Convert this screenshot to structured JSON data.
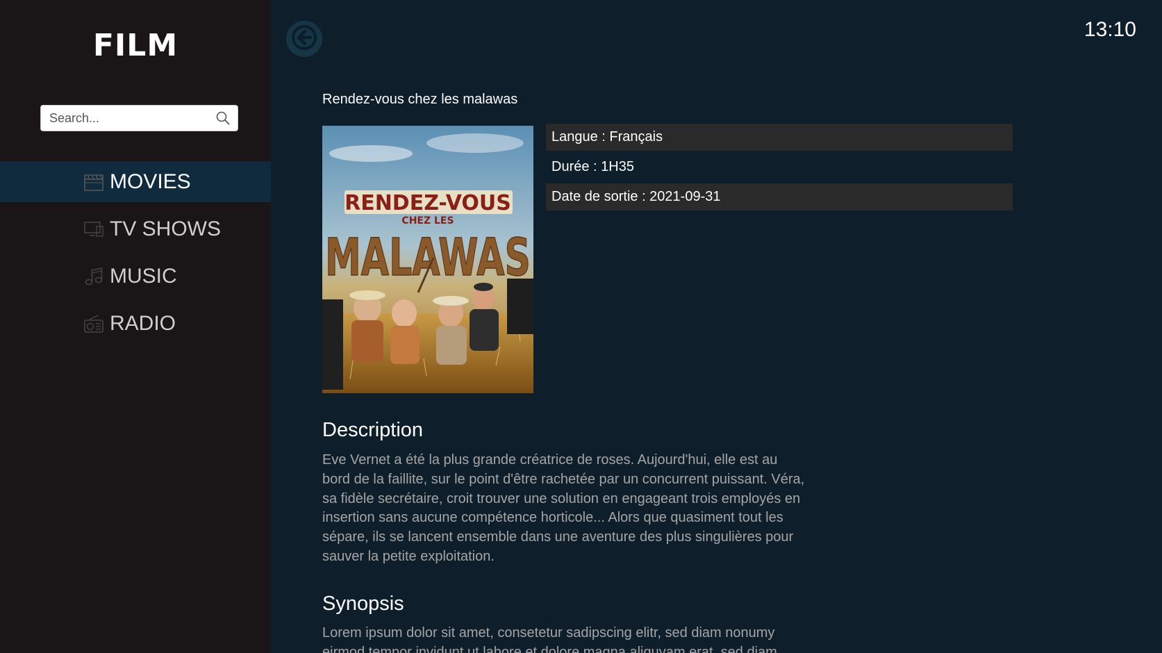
{
  "sidebar": {
    "logo": "FILM",
    "search": {
      "placeholder": "Search...",
      "value": ""
    },
    "items": [
      {
        "label": "MOVIES",
        "icon": "clapperboard-icon",
        "active": true
      },
      {
        "label": "TV SHOWS",
        "icon": "tv-icon",
        "active": false
      },
      {
        "label": "MUSIC",
        "icon": "music-note-icon",
        "active": false
      },
      {
        "label": "RADIO",
        "icon": "radio-icon",
        "active": false
      }
    ]
  },
  "header": {
    "back_icon": "arrow-left-icon",
    "clock": "13:10"
  },
  "movie": {
    "title": "Rendez-vous chez les malawas",
    "poster": {
      "line1": "RENDEZ-VOUS",
      "line2": "CHEZ LES",
      "line3": "MALAWAS"
    },
    "info": [
      "Langue : Français",
      "Durée : 1H35",
      "Date de sortie : 2021-09-31"
    ],
    "description_title": "Description",
    "description": "Eve Vernet a été la plus grande créatrice de roses. Aujourd'hui, elle est au bord de la faillite, sur le point d'être rachetée par un concurrent puissant. Véra, sa fidèle secrétaire, croit trouver une solution en engageant trois employés en insertion sans aucune compétence horticole... Alors que quasiment tout les sépare, ils se lancent ensemble dans une aventure des plus singulières pour sauver la petite exploitation.",
    "synopsis_title": "Synopsis",
    "synopsis": "Lorem ipsum dolor sit amet, consetetur sadipscing elitr, sed diam nonumy eirmod tempor invidunt ut labore et dolore magna aliquyam erat, sed diam"
  },
  "colors": {
    "sidebar_bg": "#1a1517",
    "main_bg": "#0e1f2b",
    "active_item_bg": "#0f2b3d",
    "info_row_bg": "#2a2a2a"
  }
}
